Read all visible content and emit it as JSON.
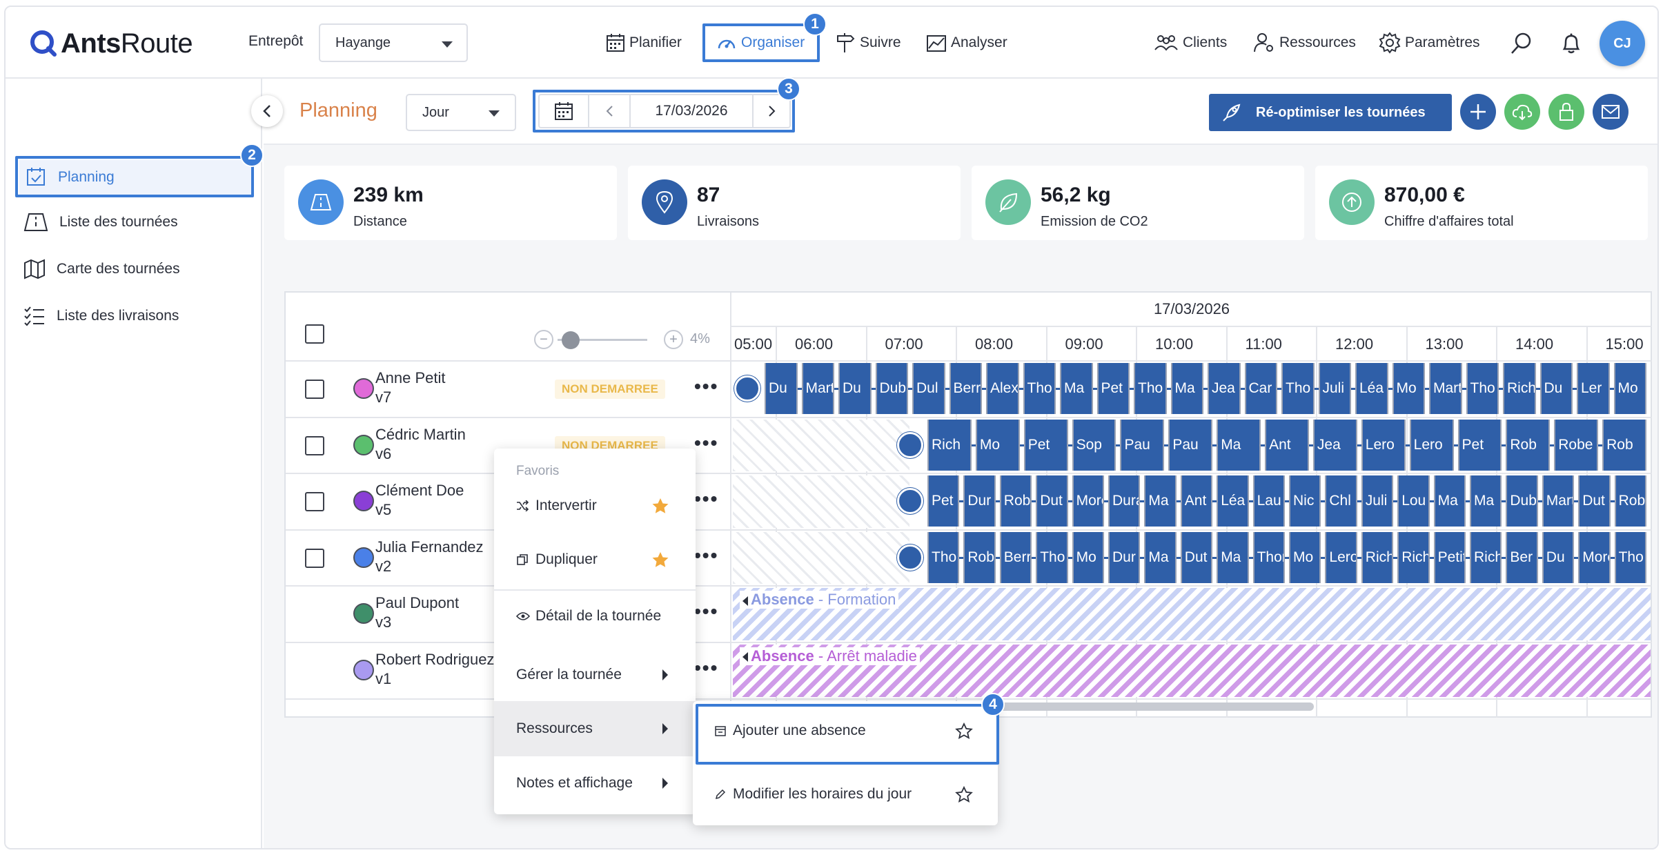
{
  "header": {
    "brand": {
      "part1": "Ants",
      "part2": "Route"
    },
    "warehouse_label": "Entrepôt",
    "warehouse_value": "Hayange",
    "nav": [
      {
        "label": "Planifier",
        "icon": "calendar-icon"
      },
      {
        "label": "Organiser",
        "icon": "speedometer-icon",
        "active": true
      },
      {
        "label": "Suivre",
        "icon": "signpost-icon"
      },
      {
        "label": "Analyser",
        "icon": "chart-icon"
      }
    ],
    "right_nav": [
      {
        "label": "Clients",
        "icon": "people-icon"
      },
      {
        "label": "Ressources",
        "icon": "user-gear-icon"
      },
      {
        "label": "Paramètres",
        "icon": "gear-icon"
      }
    ],
    "avatar_initials": "CJ"
  },
  "sidebar": {
    "items": [
      {
        "label": "Planning",
        "icon": "calendar-check-icon",
        "active": true
      },
      {
        "label": "Liste des tournées",
        "icon": "road-icon"
      },
      {
        "label": "Carte des tournées",
        "icon": "map-icon"
      },
      {
        "label": "Liste des livraisons",
        "icon": "checklist-icon"
      }
    ]
  },
  "toolbar": {
    "title": "Planning",
    "view_value": "Jour",
    "date": "17/03/2026",
    "optimize_label": "Ré-optimiser les tournées"
  },
  "kpis": [
    {
      "value": "239 km",
      "caption": "Distance",
      "icon": "road-icon",
      "color": "#4a90e2"
    },
    {
      "value": "87",
      "caption": "Livraisons",
      "icon": "pin-icon",
      "color": "#2f5fa8"
    },
    {
      "value": "56,2 kg",
      "caption": "Emission de CO2",
      "icon": "leaf-icon",
      "color": "#6cc4a1"
    },
    {
      "value": "870,00 €",
      "caption": "Chiffre d'affaires total",
      "icon": "arrow-up-icon",
      "color": "#6cc4a1"
    }
  ],
  "schedule": {
    "date_header": "17/03/2026",
    "zoom": "4%",
    "hours": [
      "05:00",
      "06:00",
      "07:00",
      "08:00",
      "09:00",
      "10:00",
      "11:00",
      "12:00",
      "13:00",
      "14:00",
      "15:00"
    ],
    "rows": [
      {
        "name": "Anne Petit",
        "vehicle": "v7",
        "color": "#e06ad8",
        "status": "NON DEMARREE",
        "checkbox": true,
        "blocks": [
          "Du",
          "Mart",
          "Du",
          "Dub",
          "Dul",
          "Berr",
          "Alex",
          "Tho",
          "Ma",
          "Pet",
          "Tho",
          "Ma",
          "Jea",
          "Car",
          "Tho",
          "Juli",
          "Léa",
          "Mo",
          "Mart",
          "Tho",
          "Rich",
          "Du",
          "Ler",
          "Mo"
        ]
      },
      {
        "name": "Cédric Martin",
        "vehicle": "v6",
        "color": "#5bbf6e",
        "status": "NON DEMARREE",
        "checkbox": true,
        "blocks": [
          "Rich",
          "Mo",
          "Pet",
          "Sop",
          "Pau",
          "Pau",
          "Ma",
          "Ant",
          "Jea",
          "Lero",
          "Lero",
          "Pet",
          "Rob",
          "Robe",
          "Rob"
        ]
      },
      {
        "name": "Clément Doe",
        "vehicle": "v5",
        "color": "#8a3fd6",
        "status": "",
        "checkbox": true,
        "blocks": [
          "Pet",
          "Dur",
          "Rob",
          "Dut",
          "More",
          "Dura",
          "Ma",
          "Ant",
          "Léa",
          "Lau",
          "Nic",
          "Chl",
          "Juli",
          "Lou",
          "Ma",
          "Ma",
          "Dub",
          "Mart",
          "Dut",
          "Rob"
        ]
      },
      {
        "name": "Julia Fernandez",
        "vehicle": "v2",
        "color": "#4a80e8",
        "status": "",
        "checkbox": true,
        "blocks": [
          "Tho",
          "Rob",
          "Berr",
          "Tho",
          "Mo",
          "Dur",
          "Ma",
          "Dut",
          "Ma",
          "Thor",
          "Mo",
          "Lero",
          "Rich",
          "Rich",
          "Petit",
          "Rich",
          "Ber",
          "Du",
          "More",
          "Tho"
        ]
      },
      {
        "name": "Paul Dupont",
        "vehicle": "v3",
        "color": "#3f8f6a",
        "status": "",
        "checkbox": false,
        "absence": {
          "label": "Absence",
          "reason": "Formation",
          "color": "#c8d2f5"
        }
      },
      {
        "name": "Robert Rodriguez",
        "vehicle": "v1",
        "color": "#a99af0",
        "status": "",
        "checkbox": false,
        "absence": {
          "label": "Absence",
          "reason": "Arrêt maladie",
          "color": "#cf9be8"
        }
      }
    ]
  },
  "context_menu": {
    "section": "Favoris",
    "items": [
      {
        "label": "Intervertir",
        "icon": "swap-icon",
        "starred": true
      },
      {
        "label": "Dupliquer",
        "icon": "copy-icon",
        "starred": true
      },
      {
        "label": "Détail de la tournée",
        "icon": "eye-icon"
      },
      {
        "label": "Gérer la tournée",
        "submenu": true
      },
      {
        "label": "Ressources",
        "submenu": true,
        "active": true
      },
      {
        "label": "Notes et affichage",
        "submenu": true
      }
    ]
  },
  "submenu": {
    "items": [
      {
        "label": "Ajouter une absence",
        "icon": "calendar-minus-icon"
      },
      {
        "label": "Modifier les horaires du jour",
        "icon": "pencil-icon"
      }
    ]
  },
  "callouts": [
    "1",
    "2",
    "3",
    "4"
  ]
}
